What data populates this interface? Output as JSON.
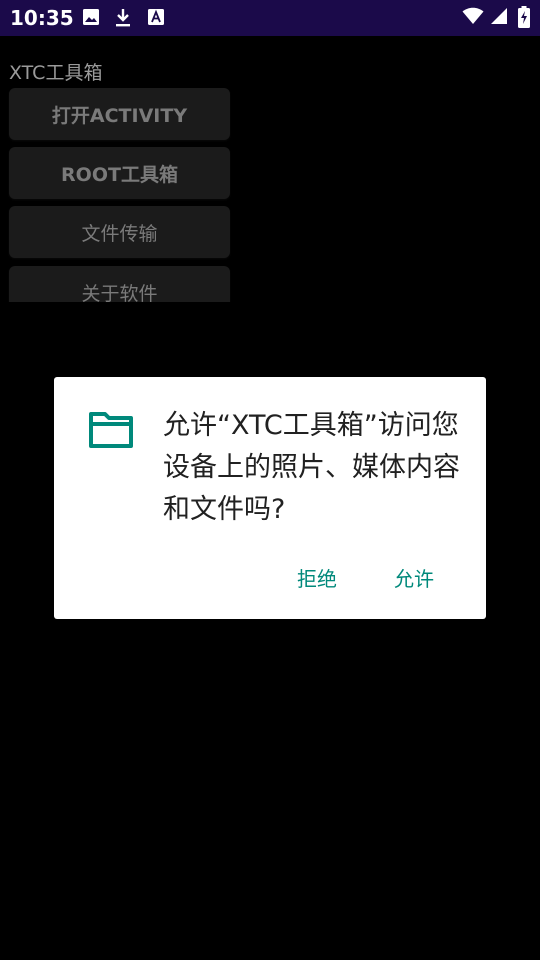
{
  "status_bar": {
    "time": "10:35",
    "left_icons": [
      "image-icon",
      "download-icon",
      "a-icon"
    ],
    "right_icons": [
      "wifi-icon",
      "signal-icon",
      "battery-charging-icon"
    ],
    "background_color": "#1b0a4a"
  },
  "app": {
    "title": "XTC工具箱",
    "buttons": [
      {
        "label": "打开ACTIVITY"
      },
      {
        "label": "ROOT工具箱"
      },
      {
        "label": "文件传输"
      },
      {
        "label": "关于软件"
      }
    ]
  },
  "dialog": {
    "icon": "folder-icon",
    "accent_color": "#00897b",
    "message": "允许“XTC工具箱”访问您设备上的照片、媒体内容和文件吗?",
    "deny_label": "拒绝",
    "allow_label": "允许"
  }
}
